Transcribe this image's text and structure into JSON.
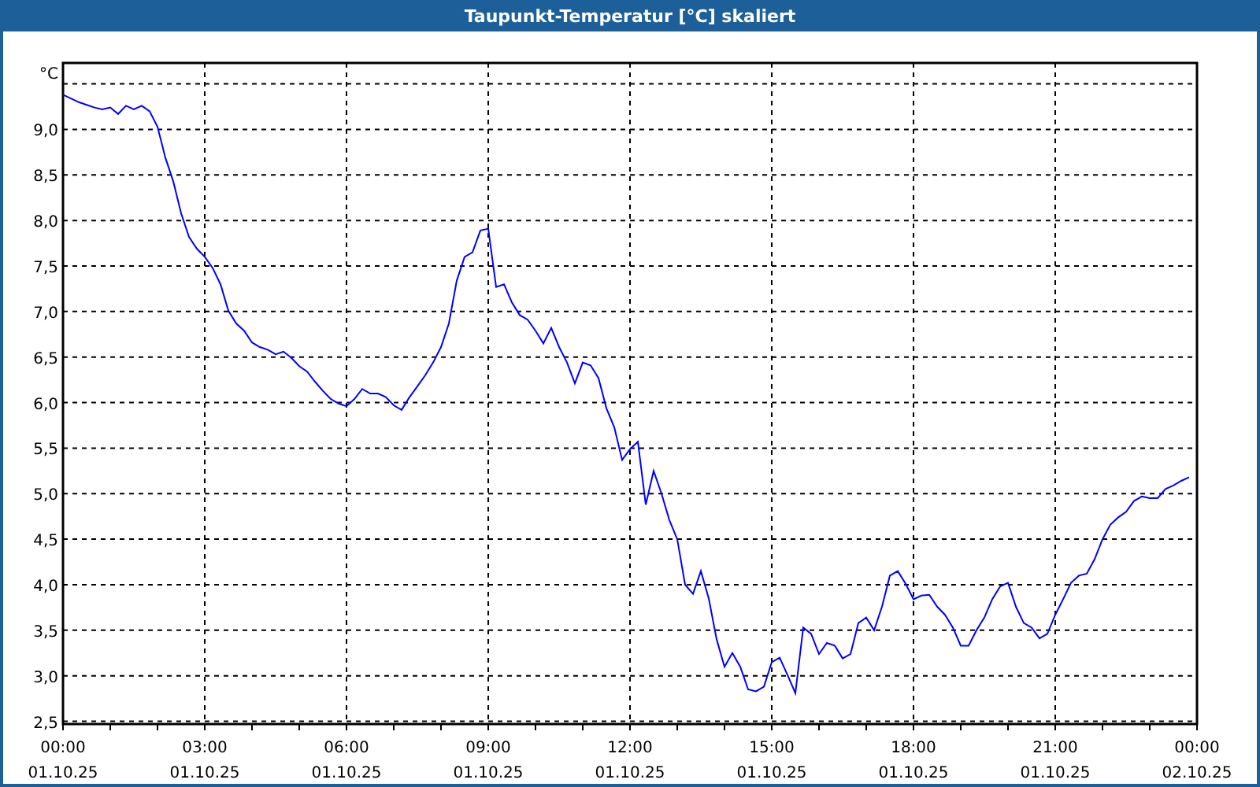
{
  "window": {
    "title": "Taupunkt-Temperatur [°C] skaliert"
  },
  "chart": {
    "chart_data": {
      "type": "line",
      "ylabel": "°C",
      "grid": true,
      "categories": [
        "00:00\n01.10.25",
        null,
        null,
        null,
        null,
        null,
        null,
        null,
        null,
        null,
        null,
        null,
        null,
        null,
        null,
        null,
        null,
        null,
        "03:00\n01.10.25",
        null,
        null,
        null,
        null,
        null,
        null,
        null,
        null,
        null,
        null,
        null,
        null,
        null,
        null,
        null,
        null,
        null,
        "06:00\n01.10.25",
        null,
        null,
        null,
        null,
        null,
        null,
        null,
        null,
        null,
        null,
        null,
        null,
        null,
        null,
        null,
        null,
        null,
        "09:00\n01.10.25",
        null,
        null,
        null,
        null,
        null,
        null,
        null,
        null,
        null,
        null,
        null,
        null,
        null,
        null,
        null,
        null,
        null,
        "12:00\n01.10.25",
        null,
        null,
        null,
        null,
        null,
        null,
        null,
        null,
        null,
        null,
        null,
        null,
        null,
        null,
        null,
        null,
        null,
        "15:00\n01.10.25",
        null,
        null,
        null,
        null,
        null,
        null,
        null,
        null,
        null,
        null,
        null,
        null,
        null,
        null,
        null,
        null,
        null,
        "18:00\n01.10.25",
        null,
        null,
        null,
        null,
        null,
        null,
        null,
        null,
        null,
        null,
        null,
        null,
        null,
        null,
        null,
        null,
        null,
        "21:00\n01.10.25",
        null,
        null,
        null,
        null,
        null,
        null,
        null,
        null,
        null,
        null,
        null,
        null,
        null,
        null,
        null,
        null,
        null,
        "00:00\n02.10.25"
      ],
      "series": [
        {
          "color": "#0000ff",
          "values": [
            9.38,
            9.34,
            9.3,
            9.27,
            9.24,
            9.22,
            9.24,
            9.17,
            9.26,
            9.22,
            9.26,
            9.2,
            9.03,
            8.69,
            8.43,
            8.08,
            7.82,
            7.69,
            7.6,
            7.48,
            7.3,
            7.01,
            6.87,
            6.79,
            6.66,
            6.61,
            6.58,
            6.53,
            6.56,
            6.49,
            6.4,
            6.34,
            6.23,
            6.13,
            6.04,
            5.99,
            5.96,
            6.04,
            6.15,
            6.1,
            6.1,
            6.06,
            5.97,
            5.92,
            6.06,
            6.18,
            6.3,
            6.44,
            6.61,
            6.87,
            7.34,
            7.6,
            7.65,
            7.89,
            7.91,
            7.27,
            7.3,
            7.1,
            6.96,
            6.91,
            6.79,
            6.65,
            6.82,
            6.61,
            6.44,
            6.21,
            6.44,
            6.41,
            6.27,
            5.94,
            5.73,
            5.37,
            5.49,
            5.57,
            4.88,
            5.25,
            5.0,
            4.71,
            4.5,
            4.0,
            3.9,
            4.15,
            3.85,
            3.4,
            3.1,
            3.25,
            3.1,
            2.85,
            2.83,
            2.88,
            3.15,
            3.2,
            3.01,
            2.81,
            3.53,
            3.46,
            3.24,
            3.36,
            3.33,
            3.19,
            3.24,
            3.58,
            3.64,
            3.5,
            3.76,
            4.1,
            4.15,
            4.01,
            3.84,
            3.88,
            3.89,
            3.76,
            3.67,
            3.53,
            3.33,
            3.33,
            3.5,
            3.64,
            3.84,
            3.98,
            4.02,
            3.76,
            3.58,
            3.53,
            3.41,
            3.46,
            3.67,
            3.84,
            4.02,
            4.1,
            4.12,
            4.28,
            4.5,
            4.66,
            4.74,
            4.8,
            4.92,
            4.97,
            4.95,
            4.95,
            5.05,
            5.09,
            5.14,
            5.18,
            null
          ]
        }
      ],
      "ylim": [
        2.47,
        9.73
      ],
      "yticks": [
        {
          "value": 2.5,
          "label": "2,5"
        },
        {
          "value": 3,
          "label": "3,0"
        },
        {
          "value": 3.5,
          "label": "3,5"
        },
        {
          "value": 4,
          "label": "4,0"
        },
        {
          "value": 4.5,
          "label": "4,5"
        },
        {
          "value": 5,
          "label": "5,0"
        },
        {
          "value": 5.5,
          "label": "5,5"
        },
        {
          "value": 6,
          "label": "6,0"
        },
        {
          "value": 6.5,
          "label": "6,5"
        },
        {
          "value": 7,
          "label": "7,0"
        },
        {
          "value": 7.5,
          "label": "7,5"
        },
        {
          "value": 8,
          "label": "8,0"
        },
        {
          "value": 8.5,
          "label": "8,5"
        },
        {
          "value": 9,
          "label": "9,0"
        }
      ]
    }
  }
}
